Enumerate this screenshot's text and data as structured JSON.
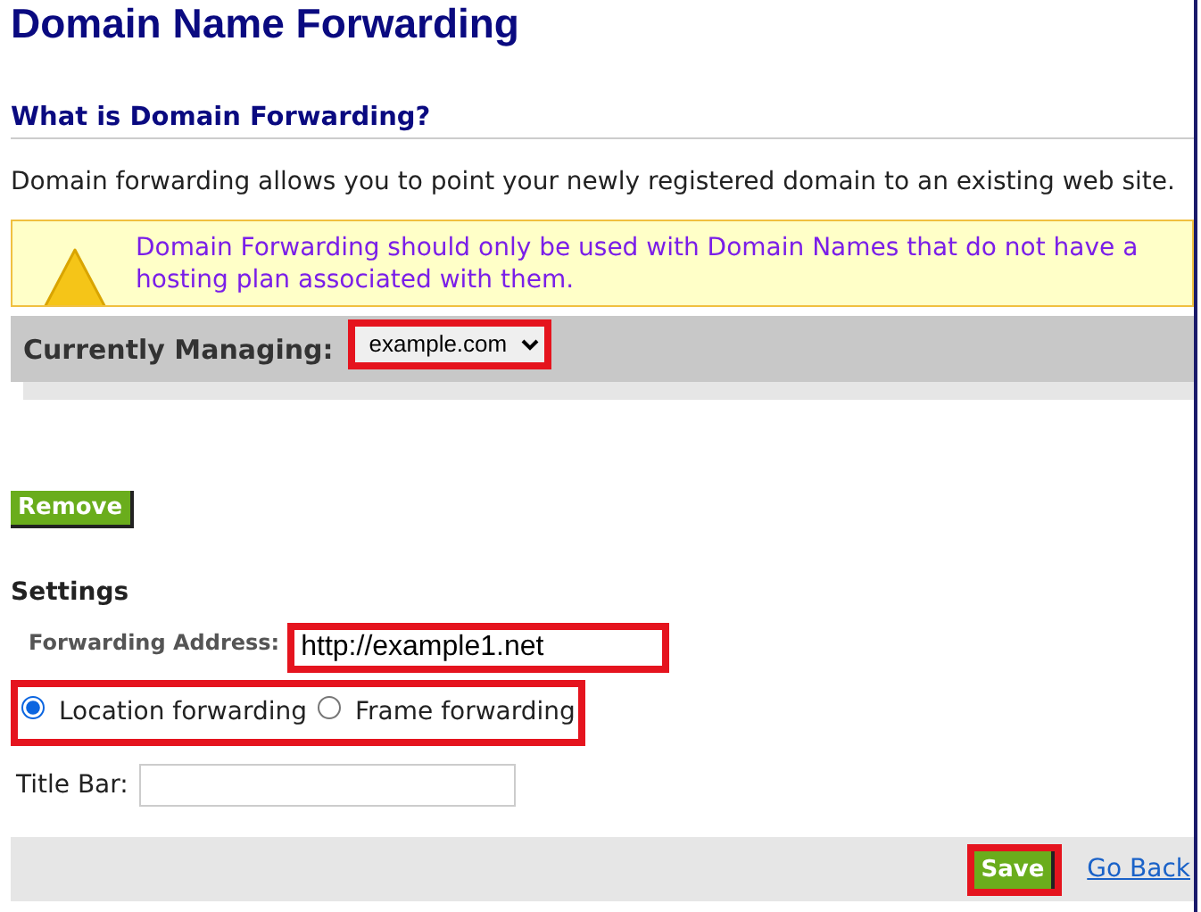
{
  "title": "Domain Name Forwarding",
  "section_heading": "What is Domain Forwarding?",
  "intro": "Domain forwarding allows you to point your newly registered domain to an existing web site.",
  "warning": {
    "text": "Domain Forwarding should only be used with Domain Names that do not have a hosting plan associated with them."
  },
  "managing": {
    "label": "Currently Managing:",
    "value": "example.com",
    "highlighted": true
  },
  "remove_button": {
    "label": "Remove"
  },
  "settings": {
    "heading": "Settings",
    "forwarding_address": {
      "label": "Forwarding Address:",
      "value": "http://example1.net",
      "highlighted": true
    },
    "forwarding_type": {
      "highlighted": true,
      "options": [
        {
          "label": "Location forwarding",
          "selected": true
        },
        {
          "label": "Frame forwarding",
          "selected": false
        }
      ]
    },
    "title_bar": {
      "label": "Title Bar:"
    }
  },
  "footer": {
    "save": {
      "label": "Save",
      "highlighted": true
    },
    "go_back": "Go Back"
  }
}
